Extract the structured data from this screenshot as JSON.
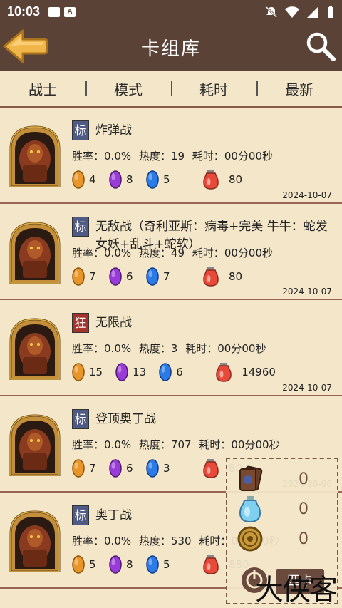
{
  "status_bar": {
    "time": "10:03"
  },
  "header": {
    "title": "卡组库",
    "back_icon": "arrow-left-icon",
    "search_icon": "search-icon"
  },
  "filters": [
    "战士",
    "模式",
    "耗时",
    "最新"
  ],
  "labels": {
    "winrate": "胜率：",
    "popularity": "热度：",
    "duration": "耗时："
  },
  "decks": [
    {
      "badge": "标",
      "badge_type": "standard",
      "name": "炸弹战",
      "winrate": "0.0%",
      "popularity": "19",
      "duration": "00分00秒",
      "orange": "4",
      "purple": "8",
      "blue": "5",
      "dust": "80",
      "date": "2024-10-07"
    },
    {
      "badge": "标",
      "badge_type": "standard",
      "name": "无敌战（奇利亚斯：病毒+完美 牛牛：蛇发女妖+乱斗+蛇软）",
      "winrate": "0.0%",
      "popularity": "49",
      "duration": "00分00秒",
      "orange": "7",
      "purple": "6",
      "blue": "7",
      "dust": "80",
      "date": "2024-10-07"
    },
    {
      "badge": "狂",
      "badge_type": "wild",
      "name": "无限战",
      "winrate": "0.0%",
      "popularity": "3",
      "duration": "00分00秒",
      "orange": "15",
      "purple": "13",
      "blue": "6",
      "dust": "14960",
      "date": "2024-10-07"
    },
    {
      "badge": "标",
      "badge_type": "standard",
      "name": "登顶奥丁战",
      "winrate": "0.0%",
      "popularity": "707",
      "duration": "00分00秒",
      "orange": "7",
      "purple": "6",
      "blue": "3",
      "dust": "80",
      "date": "2024-10-06"
    },
    {
      "badge": "标",
      "badge_type": "standard",
      "name": "奥丁战",
      "winrate": "0.0%",
      "popularity": "530",
      "duration": "00分00秒",
      "orange": "5",
      "purple": "8",
      "blue": "5",
      "dust": "880",
      "date": ""
    }
  ],
  "float_panel": {
    "cards_count": "0",
    "dust_count": "0",
    "gold_count": "0",
    "match_button": "匹卡"
  },
  "colors": {
    "header_bg": "#5b4236",
    "page_bg": "#f3e6c9",
    "divider": "#9a6355",
    "standard_badge": "#4f5b84",
    "wild_badge": "#a6322c"
  },
  "watermark": "大侠客"
}
